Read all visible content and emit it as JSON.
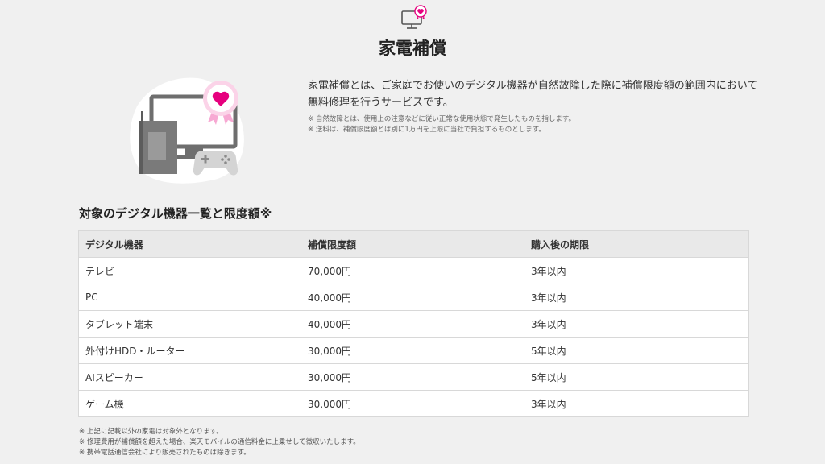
{
  "header": {
    "icon": "monitor-heart-icon",
    "title": "家電補償"
  },
  "intro": {
    "illustration": "monitor-router-gamepad-heart-badge",
    "description": "家電補償とは、ご家庭でお使いのデジタル機器が自然故障した際に補償限度額の範囲内において無料修理を行うサービスです。",
    "notes": [
      "※ 自然故障とは、使用上の注意などに従い正常な使用状態で発生したものを指します。",
      "※ 送料は、補償限度額とは別に1万円を上限に当社で負担するものとします。"
    ]
  },
  "table": {
    "title": "対象のデジタル機器一覧と限度額※",
    "headers": [
      "デジタル機器",
      "補償限度額",
      "購入後の期限"
    ],
    "rows": [
      [
        "テレビ",
        "70,000円",
        "3年以内"
      ],
      [
        "PC",
        "40,000円",
        "3年以内"
      ],
      [
        "タブレット端末",
        "40,000円",
        "3年以内"
      ],
      [
        "外付けHDD・ルーター",
        "30,000円",
        "5年以内"
      ],
      [
        "AIスピーカー",
        "30,000円",
        "5年以内"
      ],
      [
        "ゲーム機",
        "30,000円",
        "3年以内"
      ]
    ]
  },
  "footnotes": [
    "※ 上記に記載以外の家電は対象外となります。",
    "※ 修理費用が補償額を超えた場合、楽天モバイルの通信料金に上乗せして徴収いたします。",
    "※ 携帯電話通信会社により販売されたものは除きます。"
  ],
  "colors": {
    "accent_pink": "#e6007e",
    "badge_pink": "#f7a9d3",
    "device_gray": "#707070",
    "header_bg": "#e9e9e9"
  }
}
